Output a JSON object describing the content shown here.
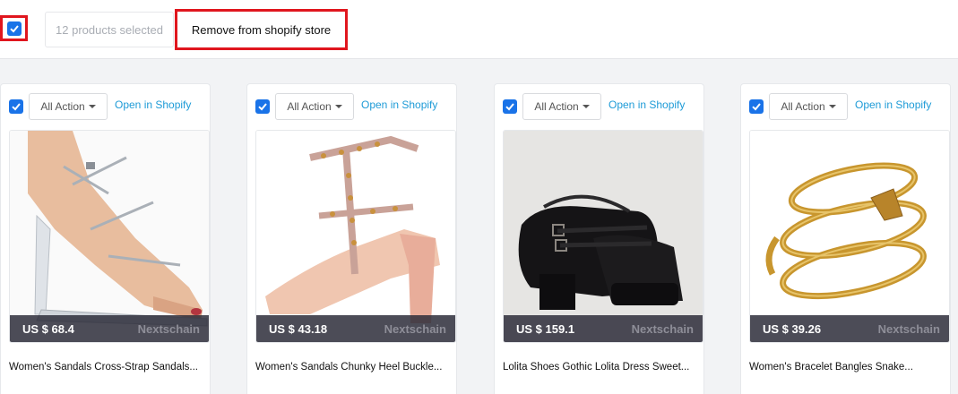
{
  "toolbar": {
    "selected_text": "12 products selected",
    "remove_label": "Remove from shopify store",
    "accent_color": "#e0161e"
  },
  "products": [
    {
      "action_label": "All Action",
      "open_label": "Open in Shopify",
      "price": "US $ 68.4",
      "vendor": "Nextschain",
      "title": "Women's Sandals Cross-Strap Sandals...",
      "image": "clear-high-heel-sandal"
    },
    {
      "action_label": "All Action",
      "open_label": "Open in Shopify",
      "price": "US $ 43.18",
      "vendor": "Nextschain",
      "title": "Women's Sandals Chunky Heel Buckle...",
      "image": "pink-studded-heel"
    },
    {
      "action_label": "All Action",
      "open_label": "Open in Shopify",
      "price": "US $ 159.1",
      "vendor": "Nextschain",
      "title": "Lolita Shoes Gothic Lolita Dress Sweet...",
      "image": "black-platform-shoe"
    },
    {
      "action_label": "All Action",
      "open_label": "Open in Shopify",
      "price": "US $ 39.26",
      "vendor": "Nextschain",
      "title": "Women's Bracelet Bangles Snake...",
      "image": "gold-snake-bangle"
    }
  ]
}
